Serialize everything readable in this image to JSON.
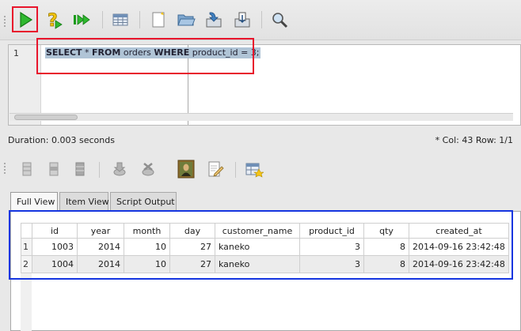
{
  "toolbar": {
    "buttons": [
      {
        "name": "run-statement-button",
        "icon": "green-play-icon"
      },
      {
        "name": "explain-plan-button",
        "icon": "yellow-question-icon"
      },
      {
        "name": "run-script-button",
        "icon": "double-play-icon"
      },
      {
        "name": "grid-options-button",
        "icon": "table-icon"
      },
      {
        "name": "new-button",
        "icon": "new-file-icon"
      },
      {
        "name": "open-button",
        "icon": "folder-icon"
      },
      {
        "name": "save-button",
        "icon": "save-arrow-icon"
      },
      {
        "name": "save-as-button",
        "icon": "save-as-icon"
      },
      {
        "name": "find-button",
        "icon": "magnifier-icon"
      }
    ]
  },
  "editor": {
    "line_number": "1",
    "sql": {
      "kw_select": "SELECT",
      "star": " * ",
      "kw_from": "FROM",
      "table": " orders ",
      "kw_where": "WHERE",
      "condition": " product_id = 3;"
    }
  },
  "status": {
    "duration": "Duration: 0.003 seconds",
    "position": "*   Col: 43 Row: 1/1"
  },
  "results_toolbar": {
    "buttons": [
      {
        "name": "insert-row-button",
        "icon": "insert-row-icon"
      },
      {
        "name": "delete-row-button",
        "icon": "delete-row-icon"
      },
      {
        "name": "column-button",
        "icon": "column-icon"
      },
      {
        "name": "commit-button",
        "icon": "commit-icon"
      },
      {
        "name": "rollback-button",
        "icon": "rollback-icon"
      },
      {
        "name": "image-view-button",
        "icon": "mona-lisa-image-icon"
      },
      {
        "name": "edit-button",
        "icon": "pencil-document-icon"
      },
      {
        "name": "export-button",
        "icon": "export-table-icon"
      }
    ]
  },
  "tabs": [
    {
      "label": "Full View",
      "active": true
    },
    {
      "label": "Item View",
      "active": false
    },
    {
      "label": "Script Output",
      "active": false
    }
  ],
  "results": {
    "columns": [
      "id",
      "year",
      "month",
      "day",
      "customer_name",
      "product_id",
      "qty",
      "created_at"
    ],
    "rows": [
      {
        "rownum": "1",
        "cells": [
          "1003",
          "2014",
          "10",
          "27",
          "kaneko",
          "3",
          "8",
          "2014-09-16 23:42:48"
        ]
      },
      {
        "rownum": "2",
        "cells": [
          "1004",
          "2014",
          "10",
          "27",
          "kaneko",
          "3",
          "8",
          "2014-09-16 23:42:48"
        ]
      }
    ]
  },
  "colors": {
    "highlight_red": "#e8152c",
    "highlight_blue": "#1535e0",
    "selection": "#b0c4d6"
  }
}
